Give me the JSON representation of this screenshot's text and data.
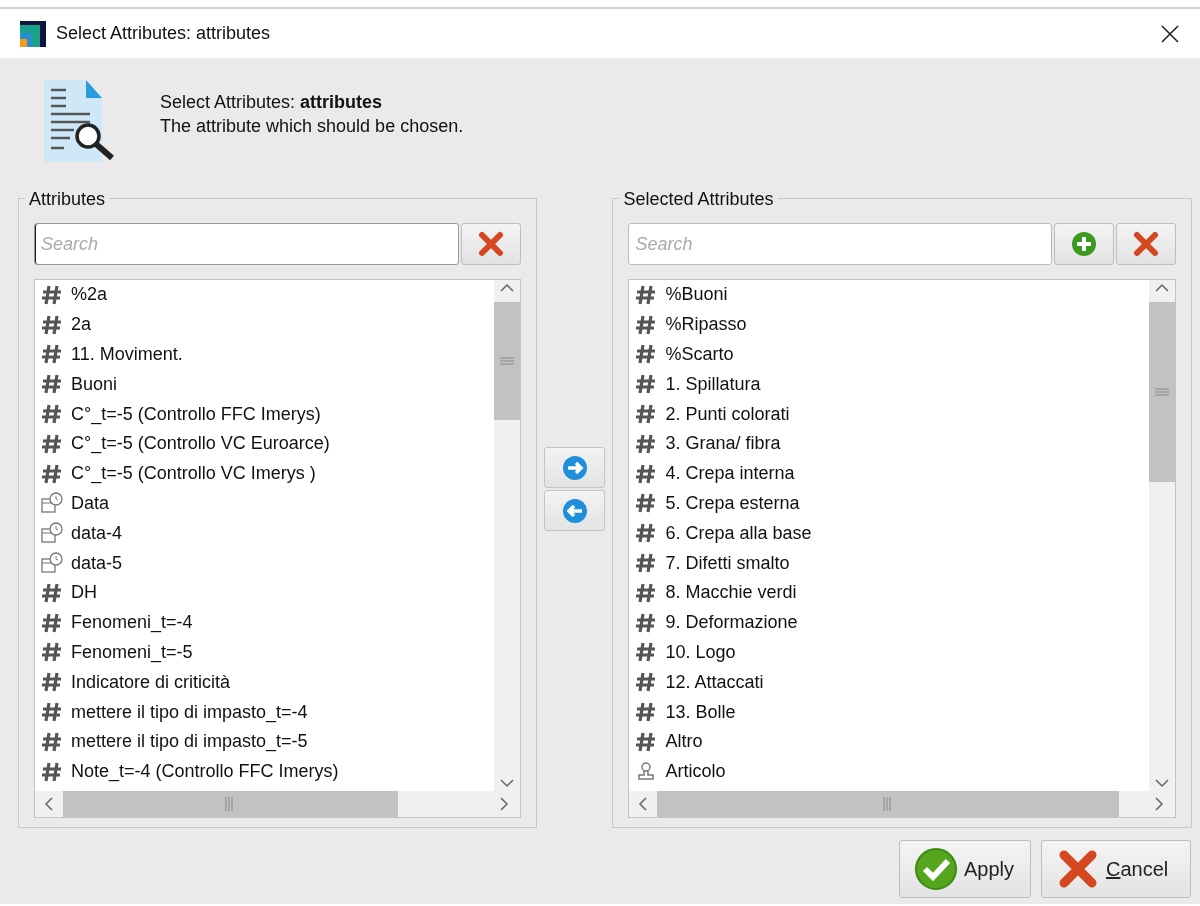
{
  "window": {
    "title": "Select Attributes: attributes"
  },
  "header": {
    "title": "Select Attributes: **attributes**",
    "description": "The attribute which should be chosen."
  },
  "available": {
    "legend": "Attributes",
    "search": {
      "placeholder": "Search",
      "focused": true
    },
    "items": [
      {
        "label": "%2a",
        "kind": "number"
      },
      {
        "label": "2a",
        "kind": "number"
      },
      {
        "label": "11. Moviment.",
        "kind": "number"
      },
      {
        "label": "Buoni",
        "kind": "number"
      },
      {
        "label": "C°_t=-5 (Controllo FFC Imerys)",
        "kind": "number"
      },
      {
        "label": "C°_t=-5 (Controllo VC Euroarce)",
        "kind": "number"
      },
      {
        "label": "C°_t=-5 (Controllo VC Imerys )",
        "kind": "number"
      },
      {
        "label": "Data",
        "kind": "date"
      },
      {
        "label": "data-4",
        "kind": "date"
      },
      {
        "label": "data-5",
        "kind": "date"
      },
      {
        "label": "DH",
        "kind": "number"
      },
      {
        "label": "Fenomeni_t=-4",
        "kind": "number"
      },
      {
        "label": "Fenomeni_t=-5",
        "kind": "number"
      },
      {
        "label": "Indicatore di criticità",
        "kind": "number"
      },
      {
        "label": "mettere il tipo di impasto_t=-4",
        "kind": "number"
      },
      {
        "label": "mettere il tipo di impasto_t=-5",
        "kind": "number"
      },
      {
        "label": "Note_t=-4 (Controllo FFC Imerys)",
        "kind": "number"
      }
    ]
  },
  "selected": {
    "legend": "Selected Attributes",
    "search": {
      "placeholder": "Search",
      "focused": false
    },
    "items": [
      {
        "label": "%Buoni",
        "kind": "number"
      },
      {
        "label": "%Ripasso",
        "kind": "number"
      },
      {
        "label": "%Scarto",
        "kind": "number"
      },
      {
        "label": "1. Spillatura",
        "kind": "number"
      },
      {
        "label": "2. Punti colorati",
        "kind": "number"
      },
      {
        "label": "3. Grana/ fibra",
        "kind": "number"
      },
      {
        "label": "4. Crepa interna",
        "kind": "number"
      },
      {
        "label": "5. Crepa esterna",
        "kind": "number"
      },
      {
        "label": "6. Crepa alla base",
        "kind": "number"
      },
      {
        "label": "7. Difetti smalto",
        "kind": "number"
      },
      {
        "label": "8. Macchie verdi",
        "kind": "number"
      },
      {
        "label": "9. Deformazione",
        "kind": "number"
      },
      {
        "label": "10. Logo",
        "kind": "number"
      },
      {
        "label": "12. Attaccati",
        "kind": "number"
      },
      {
        "label": "13. Bolle",
        "kind": "number"
      },
      {
        "label": "Altro",
        "kind": "number"
      },
      {
        "label": "Articolo",
        "kind": "other"
      }
    ]
  },
  "buttons": [
    {
      "label": "Apply",
      "kind": "apply",
      "underline_first": false
    },
    {
      "label": "Cancel",
      "kind": "cancel",
      "underline_first": true
    }
  ]
}
